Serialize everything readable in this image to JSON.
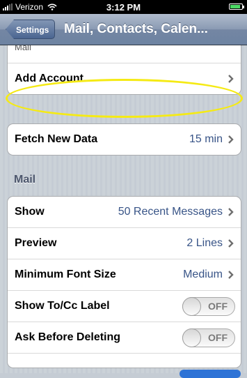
{
  "status": {
    "carrier": "Verizon",
    "time": "3:12 PM"
  },
  "nav": {
    "back_label": "Settings",
    "title": "Mail, Contacts, Calen..."
  },
  "accounts": {
    "mail_label": "Mail",
    "add_account_label": "Add Account..."
  },
  "fetch": {
    "label": "Fetch New Data",
    "value": "15 min"
  },
  "mail_section": {
    "header": "Mail",
    "rows": [
      {
        "label": "Show",
        "value": "50 Recent Messages"
      },
      {
        "label": "Preview",
        "value": "2 Lines"
      },
      {
        "label": "Minimum Font Size",
        "value": "Medium"
      },
      {
        "label": "Show To/Cc Label",
        "toggle": "OFF"
      },
      {
        "label": "Ask Before Deleting",
        "toggle": "OFF"
      }
    ]
  },
  "colors": {
    "highlight": "#f5ea14",
    "value_text": "#385487",
    "toggle_on": "#2e73d6"
  },
  "battery_level": 0.85
}
